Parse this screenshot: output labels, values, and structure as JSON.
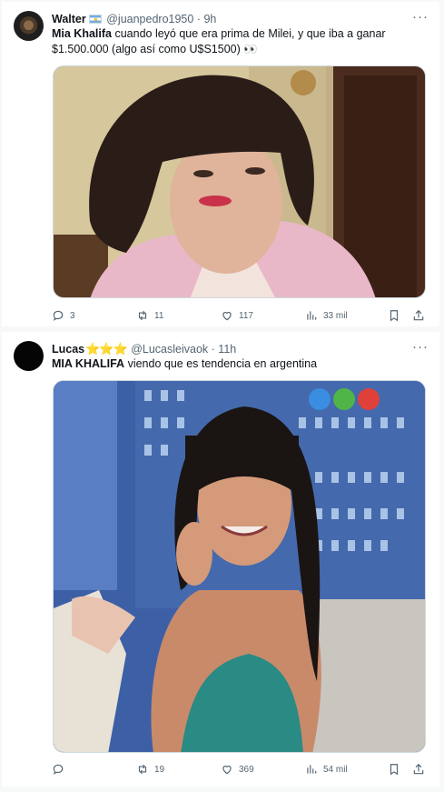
{
  "tweets": [
    {
      "name": "Walter",
      "flag_icon": "argentina-flag-icon",
      "handle": "@juanpedro1950",
      "separator": "·",
      "time": "9h",
      "more_icon": "···",
      "text_bold": "Mia Khalifa",
      "text_rest": " cuando leyó que era prima de Milei, y que iba a ganar $1.500.000 (algo así como U$S1500) ",
      "text_emoji": "👀",
      "media_alt": "photo",
      "replies": "3",
      "reposts": "11",
      "likes": "117",
      "views": "33 mil"
    },
    {
      "name": "Lucas",
      "badge": "⭐⭐⭐",
      "handle": "@Lucasleivaok",
      "separator": "·",
      "time": "11h",
      "more_icon": "···",
      "text_bold": "MIA KHALIFA",
      "text_rest": " viendo que es tendencia en argentina",
      "media_alt": "photo",
      "replies": "",
      "reposts": "19",
      "likes": "369",
      "views": "54 mil"
    }
  ],
  "colors": {
    "text": "#0f1419",
    "secondary": "#536471",
    "border": "#cfd9de",
    "background": "#f7f9f9"
  }
}
